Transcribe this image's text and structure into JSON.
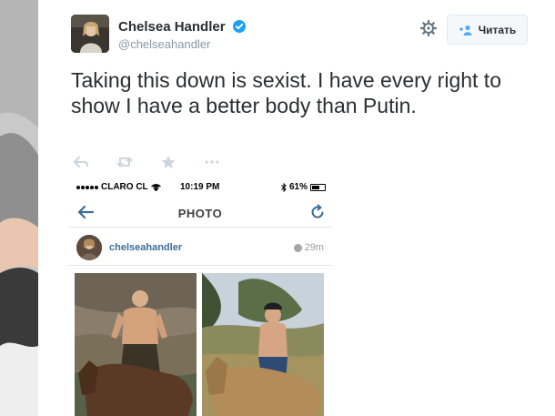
{
  "tweet": {
    "author_name": "Chelsea Handler",
    "author_handle": "@chelseahandler",
    "follow_label": "Читать",
    "text": "Taking this down is sexist. I have every right to show I have a better body than Putin.",
    "actions": [
      "reply-icon",
      "retweet-icon",
      "favorite-icon",
      "more-icon"
    ]
  },
  "media": {
    "status_bar": {
      "carrier": "CLARO CL",
      "time": "10:19 PM",
      "battery": "61%",
      "battery_level": 0.61
    },
    "header_title": "PHOTO",
    "post": {
      "username": "chelseahandler",
      "age": "29m"
    }
  },
  "colors": {
    "verified": "#1da1f2",
    "username_link": "#3b6e96",
    "text": "#292f33",
    "muted": "#8899a6",
    "instagram_blue": "#3b6e96"
  }
}
